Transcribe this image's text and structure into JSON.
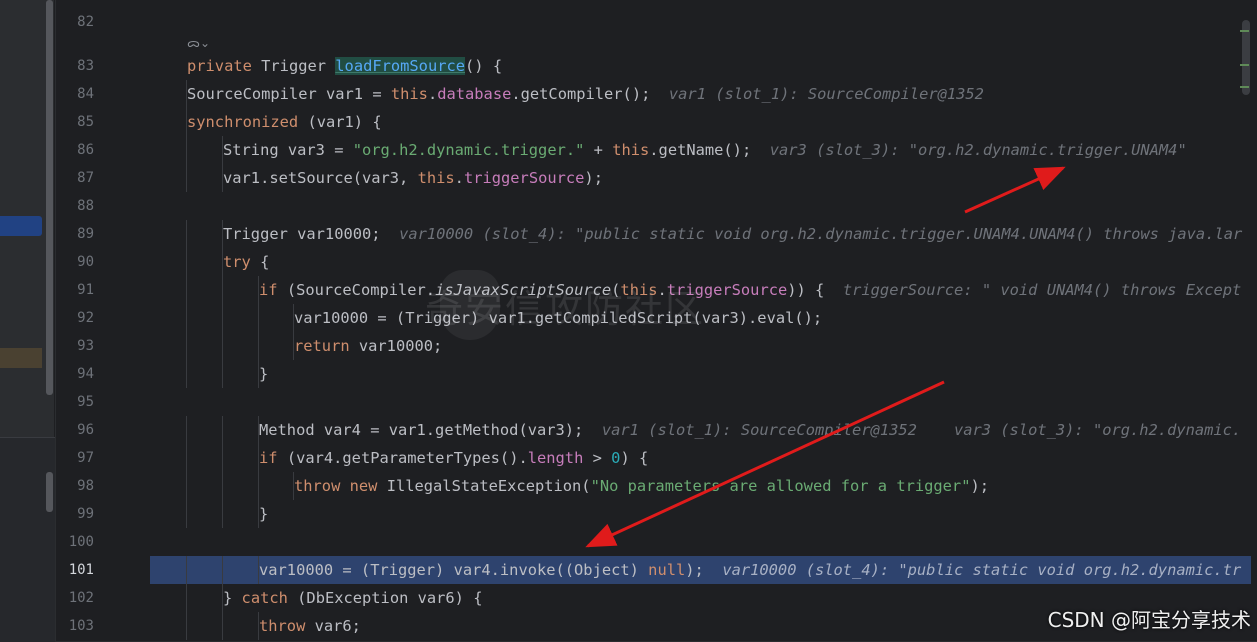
{
  "editor": {
    "lines": [
      {
        "n": "82",
        "indent": 0,
        "parts": []
      },
      {
        "n": "83",
        "indent": 0,
        "parts": [
          {
            "t": "private ",
            "c": "k"
          },
          {
            "t": "Trigger "
          },
          {
            "t": "loadFromSource",
            "c": "hl"
          },
          {
            "t": "() {"
          }
        ]
      },
      {
        "n": "84",
        "indent": 1,
        "parts": [
          {
            "t": "SourceCompiler var1 = "
          },
          {
            "t": "this",
            "c": "k"
          },
          {
            "t": "."
          },
          {
            "t": "database",
            "c": "field"
          },
          {
            "t": ".getCompiler();"
          },
          {
            "t": "  var1 (slot_1): SourceCompiler@1352",
            "c": "hint"
          }
        ]
      },
      {
        "n": "85",
        "indent": 1,
        "parts": [
          {
            "t": "synchronized ",
            "c": "k"
          },
          {
            "t": "(var1) {"
          }
        ]
      },
      {
        "n": "86",
        "indent": 2,
        "parts": [
          {
            "t": "String var3 = "
          },
          {
            "t": "\"org.h2.dynamic.trigger.\"",
            "c": "s"
          },
          {
            "t": " + "
          },
          {
            "t": "this",
            "c": "k"
          },
          {
            "t": ".getName();"
          },
          {
            "t": "  var3 (slot_3): \"org.h2.dynamic.trigger.UNAM4\"",
            "c": "hint"
          }
        ]
      },
      {
        "n": "87",
        "indent": 2,
        "parts": [
          {
            "t": "var1.setSource(var3, "
          },
          {
            "t": "this",
            "c": "k"
          },
          {
            "t": "."
          },
          {
            "t": "triggerSource",
            "c": "field"
          },
          {
            "t": ");"
          }
        ]
      },
      {
        "n": "88",
        "indent": 0,
        "parts": []
      },
      {
        "n": "89",
        "indent": 2,
        "parts": [
          {
            "t": "Trigger var10000;"
          },
          {
            "t": "  var10000 (slot_4): \"public static void org.h2.dynamic.trigger.UNAM4.UNAM4() throws java.lar",
            "c": "hint"
          }
        ]
      },
      {
        "n": "90",
        "indent": 2,
        "parts": [
          {
            "t": "try",
            "c": "k"
          },
          {
            "t": " {"
          }
        ]
      },
      {
        "n": "91",
        "indent": 3,
        "parts": [
          {
            "t": "if",
            "c": "k"
          },
          {
            "t": " (SourceCompiler."
          },
          {
            "t": "isJavaxScriptSource",
            "c": "it"
          },
          {
            "t": "("
          },
          {
            "t": "this",
            "c": "k"
          },
          {
            "t": "."
          },
          {
            "t": "triggerSource",
            "c": "field"
          },
          {
            "t": ")) {"
          },
          {
            "t": "  triggerSource: \" void UNAM4() throws Except",
            "c": "hint"
          }
        ]
      },
      {
        "n": "92",
        "indent": 4,
        "parts": [
          {
            "t": "var10000 = (Trigger) var1.getCompiledScript(var3).eval();"
          }
        ]
      },
      {
        "n": "93",
        "indent": 4,
        "parts": [
          {
            "t": "return",
            "c": "k"
          },
          {
            "t": " var10000;"
          }
        ]
      },
      {
        "n": "94",
        "indent": 3,
        "parts": [
          {
            "t": "}"
          }
        ]
      },
      {
        "n": "95",
        "indent": 0,
        "parts": []
      },
      {
        "n": "96",
        "indent": 3,
        "parts": [
          {
            "t": "Method var4 = var1.getMethod(var3);"
          },
          {
            "t": "  var1 (slot_1): SourceCompiler@1352    var3 (slot_3): \"org.h2.dynamic.",
            "c": "hint"
          }
        ]
      },
      {
        "n": "97",
        "indent": 3,
        "parts": [
          {
            "t": "if",
            "c": "k"
          },
          {
            "t": " (var4.getParameterTypes()."
          },
          {
            "t": "length",
            "c": "field"
          },
          {
            "t": " > "
          },
          {
            "t": "0",
            "c": "n"
          },
          {
            "t": ") {"
          }
        ]
      },
      {
        "n": "98",
        "indent": 4,
        "parts": [
          {
            "t": "throw",
            "c": "k"
          },
          {
            "t": " "
          },
          {
            "t": "new",
            "c": "k"
          },
          {
            "t": " IllegalStateException("
          },
          {
            "t": "\"No parameters are allowed for a trigger\"",
            "c": "s"
          },
          {
            "t": ");"
          }
        ]
      },
      {
        "n": "99",
        "indent": 3,
        "parts": [
          {
            "t": "}"
          }
        ]
      },
      {
        "n": "100",
        "indent": 0,
        "parts": []
      },
      {
        "n": "101",
        "indent": 3,
        "current": true,
        "parts": [
          {
            "t": "var10000 = (Trigger) var4.invoke((Object) "
          },
          {
            "t": "null",
            "c": "k"
          },
          {
            "t": ");"
          },
          {
            "t": "  var10000 (slot_4): \"public static void org.h2.dynamic.tr",
            "c": "hint"
          }
        ]
      },
      {
        "n": "102",
        "indent": 2,
        "parts": [
          {
            "t": "} "
          },
          {
            "t": "catch",
            "c": "k"
          },
          {
            "t": " (DbException var6) {"
          }
        ]
      },
      {
        "n": "103",
        "indent": 3,
        "parts": [
          {
            "t": "throw",
            "c": "k"
          },
          {
            "t": " var6;"
          }
        ]
      }
    ],
    "method_meta": "ᯅ⌄"
  },
  "watermark": "奇安信攻防社区",
  "credit": "CSDN @阿宝分享技术",
  "colors": {
    "background": "#1e1f22",
    "current_line": "#2e436e",
    "keyword": "#cf8e6d",
    "method": "#56a8f5",
    "field": "#c77dbb",
    "string": "#6aab73",
    "number": "#2aacb8",
    "hint": "#6f737a",
    "arrow": "#e01b1b"
  }
}
